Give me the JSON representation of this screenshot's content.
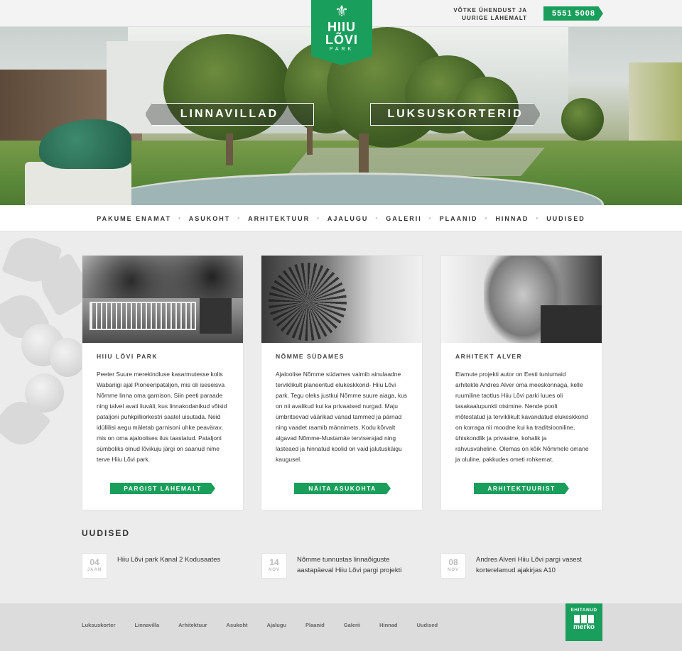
{
  "header": {
    "logo_line1": "HIIU",
    "logo_line2": "LÕVI",
    "logo_line3": "PARK",
    "contact_line1": "VÕTKE ÜHENDUST JA",
    "contact_line2": "UURIGE LÄHEMALT",
    "phone": "5551 5008"
  },
  "hero": {
    "left_button": "LINNAVILLAD",
    "right_button": "LUKSUSKORTERID"
  },
  "nav": {
    "items": [
      "PAKUME ENAMAT",
      "ASUKOHT",
      "ARHITEKTUUR",
      "AJALUGU",
      "GALERII",
      "PLAANID",
      "HINNAD",
      "UUDISED"
    ]
  },
  "cards": [
    {
      "title": "HIIU LÕVI PARK",
      "text": "Peeter Suure merekindluse kasarmutesse kolis Wabariigi ajal Pioneeripataljon, mis oli iseseisva Nõmme linna oma garnison. Siin peeti paraade ning talvel avati liuväli, kus linnakodanikud võisid pataljoni puhkpilliorkestri saatel uisutada. Neid idüllilisi aegu mäletab garnisoni uhke peavärav, mis on oma ajaloolises ilus taastatud. Pataljoni sümboliks olnud lõvikuju järgi on saanud nime terve Hiiu Lõvi park.",
      "button": "PARGIST LÄHEMALT"
    },
    {
      "title": "NÕMME SÜDAMES",
      "text": "Ajaloolise Nõmme südames valmib ainulaadne terviklikult planeeritud elukeskkond- Hiiu Lõvi park. Tegu oleks justkui Nõmme suure aiaga, kus on nii avalikud kui ka privaatsed nurgad. Maju ümbritsevad väärikad vanad tammed ja pärnad ning vaadet raamib männimets. Kodu kõrvalt algavad Nõmme-Mustamäe terviserajad ning lasteaed ja hinnatud koolid on vaid jalutuskäigu kaugusel.",
      "button": "NÄITA ASUKOHTA"
    },
    {
      "title": "ARHITEKT ALVER",
      "text": "Elamute projekti autor on Eesti tuntumaid arhitekte Andres Alver oma meeskonnaga, kelle ruumiline taotlus Hiiu Lõvi parki luues oli tasakaalupunkti otsimine. Nende poolt mõtestatud ja terviklikult kavandatud elukeskkond on korraga nii moodne kui ka traditsiooniline, ühiskondlik ja privaatne, kohalik ja rahvusvaheline. Olemas on kõik Nõmmele omane ja oluline, pakkudes ometi rohkemat.",
      "button": "ARHITEKTUURIST"
    }
  ],
  "news": {
    "title": "UUDISED",
    "items": [
      {
        "day": "04",
        "month": "JAAN",
        "text": "Hiiu Lõvi park Kanal 2 Kodusaates"
      },
      {
        "day": "14",
        "month": "NOV",
        "text": "Nõmme tunnustas linnaõiguste aastapäeval Hiiu Lõvi pargi projekti"
      },
      {
        "day": "08",
        "month": "NOV",
        "text": "Andres Alveri Hiiu Lõvi pargi vasest korterelamud ajakirjas A10"
      }
    ]
  },
  "footer": {
    "items": [
      "Luksuskorter",
      "Linnavilla",
      "Arhitektuur",
      "Asukoht",
      "Ajalugu",
      "Plaanid",
      "Galerii",
      "Hinnad",
      "Uudised"
    ],
    "badge_line1": "EHITANUD",
    "badge_line2": "merko"
  },
  "colors": {
    "accent": "#1a9e5c"
  }
}
